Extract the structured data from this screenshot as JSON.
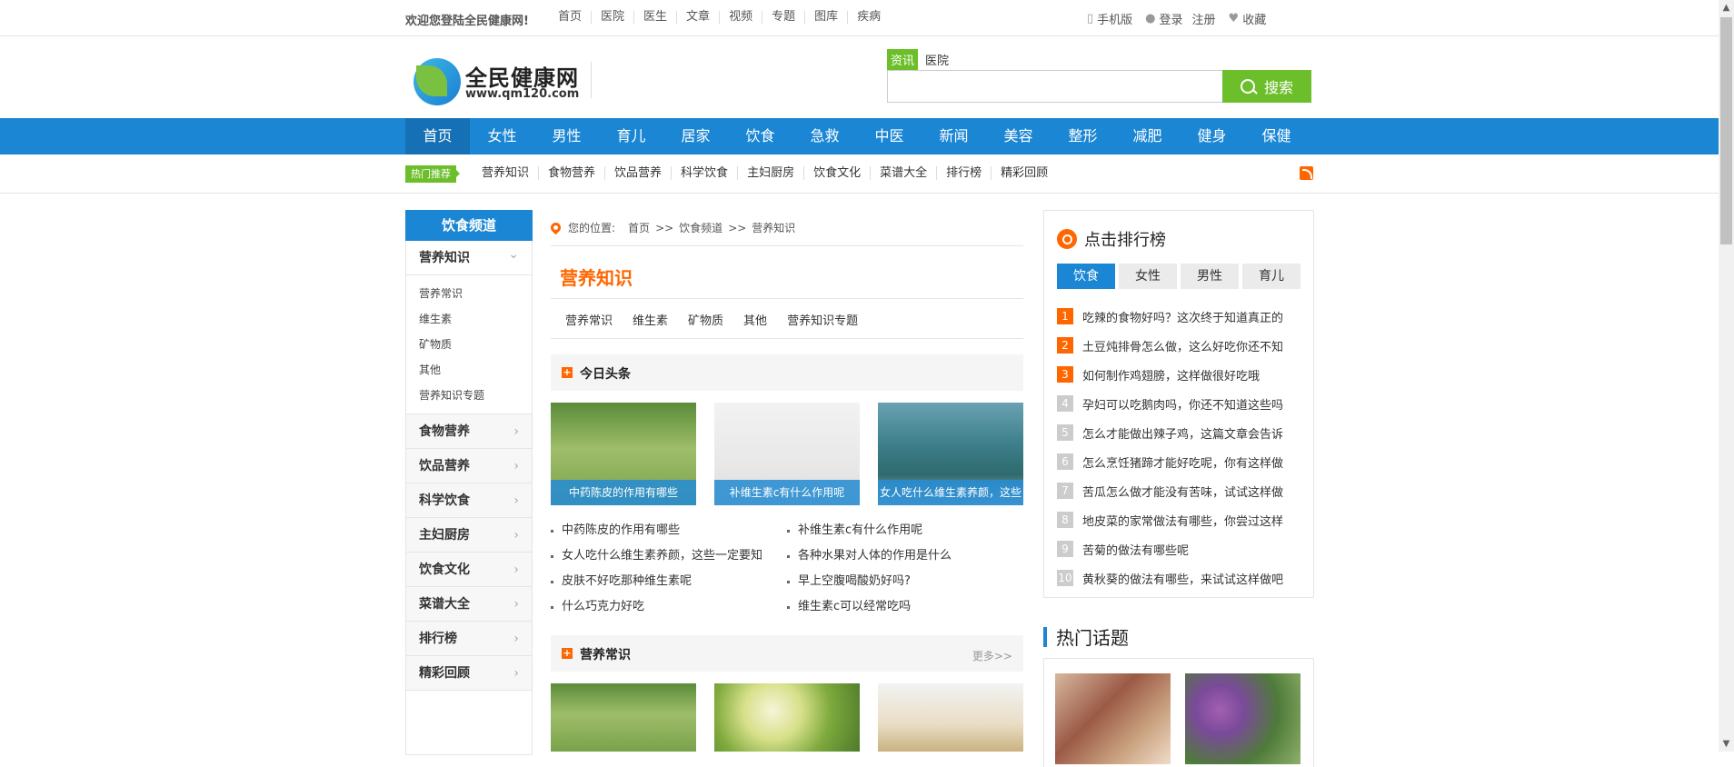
{
  "topbar": {
    "welcome": "欢迎您登陆全民健康网!",
    "nav": [
      "首页",
      "医院",
      "医生",
      "文章",
      "视频",
      "专题",
      "图库",
      "疾病"
    ],
    "mobile": "手机版",
    "login": "登录",
    "register": "注册",
    "favorite": "收藏"
  },
  "logo": {
    "name": "全民健康网",
    "url": "www.qm120.com"
  },
  "search": {
    "tab_active": "资讯",
    "tab_other": "医院",
    "placeholder": "",
    "button": "搜索"
  },
  "mainnav": [
    "首页",
    "女性",
    "男性",
    "育儿",
    "居家",
    "饮食",
    "急救",
    "中医",
    "新闻",
    "美容",
    "整形",
    "减肥",
    "健身",
    "保健"
  ],
  "subnav": {
    "hot_label": "热门推荐",
    "links": [
      "营养知识",
      "食物营养",
      "饮品营养",
      "科学饮食",
      "主妇厨房",
      "饮食文化",
      "菜谱大全",
      "排行榜",
      "精彩回顾"
    ]
  },
  "sidebar": {
    "title": "饮食频道",
    "open_category": "营养知识",
    "sub_items": [
      "营养常识",
      "维生素",
      "矿物质",
      "其他",
      "营养知识专题"
    ],
    "categories": [
      "食物营养",
      "饮品营养",
      "科学饮食",
      "主妇厨房",
      "饮食文化",
      "菜谱大全",
      "排行榜",
      "精彩回顾"
    ]
  },
  "breadcrumb": {
    "prefix": "您的位置:",
    "items": [
      "首页",
      ">>",
      "饮食频道",
      ">>",
      "营养知识"
    ]
  },
  "page": {
    "title": "营养知识",
    "tabs": [
      "营养常识",
      "维生素",
      "矿物质",
      "其他",
      "营养知识专题"
    ]
  },
  "headlines": {
    "title": "今日头条",
    "pics": [
      "中药陈皮的作用有哪些",
      "补维生素c有什么作用呢",
      "女人吃什么维生素养颜，这些"
    ],
    "left_list": [
      "中药陈皮的作用有哪些",
      "女人吃什么维生素养颜，这些一定要知",
      "皮肤不好吃那种维生素呢",
      "什么巧克力好吃"
    ],
    "right_list": [
      "补维生素c有什么作用呢",
      "各种水果对人体的作用是什么",
      "早上空腹喝酸奶好吗?",
      "维生素c可以经常吃吗"
    ]
  },
  "section2": {
    "title": "营养常识",
    "more": "更多>>"
  },
  "rank": {
    "title": "点击排行榜",
    "tabs": [
      "饮食",
      "女性",
      "男性",
      "育儿"
    ],
    "items": [
      {
        "n": "1",
        "text": "吃辣的食物好吗？这次终于知道真正的"
      },
      {
        "n": "2",
        "text": "土豆炖排骨怎么做，这么好吃你还不知"
      },
      {
        "n": "3",
        "text": "如何制作鸡翅膀，这样做很好吃哦"
      },
      {
        "n": "4",
        "text": "孕妇可以吃鹅肉吗，你还不知道这些吗"
      },
      {
        "n": "5",
        "text": "怎么才能做出辣子鸡，这篇文章会告诉"
      },
      {
        "n": "6",
        "text": "怎么烹饪猪蹄才能好吃呢，你有这样做"
      },
      {
        "n": "7",
        "text": "苦瓜怎么做才能没有苦味，试试这样做"
      },
      {
        "n": "8",
        "text": "地皮菜的家常做法有哪些，你尝过这样"
      },
      {
        "n": "9",
        "text": "苦菊的做法有哪些呢"
      },
      {
        "n": "10",
        "text": "黄秋葵的做法有哪些，来试试这样做吧"
      }
    ]
  },
  "topics": {
    "title": "热门话题"
  }
}
